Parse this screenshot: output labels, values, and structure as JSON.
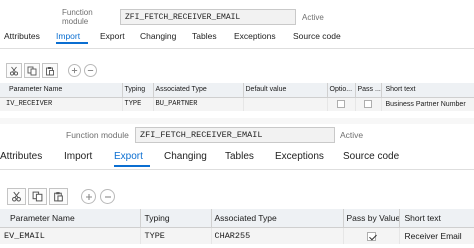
{
  "panel1": {
    "fm_label": "Function module",
    "fm_value": "ZFI_FETCH_RECEIVER_EMAIL",
    "status": "Active",
    "tabs": [
      "Attributes",
      "Import",
      "Export",
      "Changing",
      "Tables",
      "Exceptions",
      "Source code"
    ],
    "active_tab": "Import",
    "columns": [
      "Parameter Name",
      "Typing",
      "Associated Type",
      "Default value",
      "Optio...",
      "Pass ...",
      "Short text"
    ],
    "rows": [
      {
        "param": "IV_RECEIVER",
        "typing": "TYPE",
        "assoc": "BU_PARTNER",
        "default": "",
        "optional": false,
        "pass_by_value": false,
        "short_text": "Business Partner Number"
      }
    ]
  },
  "panel2": {
    "fm_label": "Function module",
    "fm_value": "ZFI_FETCH_RECEIVER_EMAIL",
    "status": "Active",
    "tabs": [
      "Attributes",
      "Import",
      "Export",
      "Changing",
      "Tables",
      "Exceptions",
      "Source code"
    ],
    "active_tab": "Export",
    "columns": [
      "Parameter Name",
      "Typing",
      "Associated Type",
      "Pass by Value",
      "Short text"
    ],
    "rows": [
      {
        "param": "EV_EMAIL",
        "typing": "TYPE",
        "assoc": "CHAR255",
        "pass_by_value": true,
        "short_text": "Receiver Email"
      }
    ]
  },
  "icons": [
    "scissors-icon",
    "copy-icon",
    "paste-icon",
    "insert-row-icon",
    "delete-row-icon"
  ],
  "colors": {
    "accent": "#0a6ed1",
    "header_bg": "#eef1f4",
    "field_bg": "#f2f2f2",
    "row_bg": "#f4f4f4"
  }
}
